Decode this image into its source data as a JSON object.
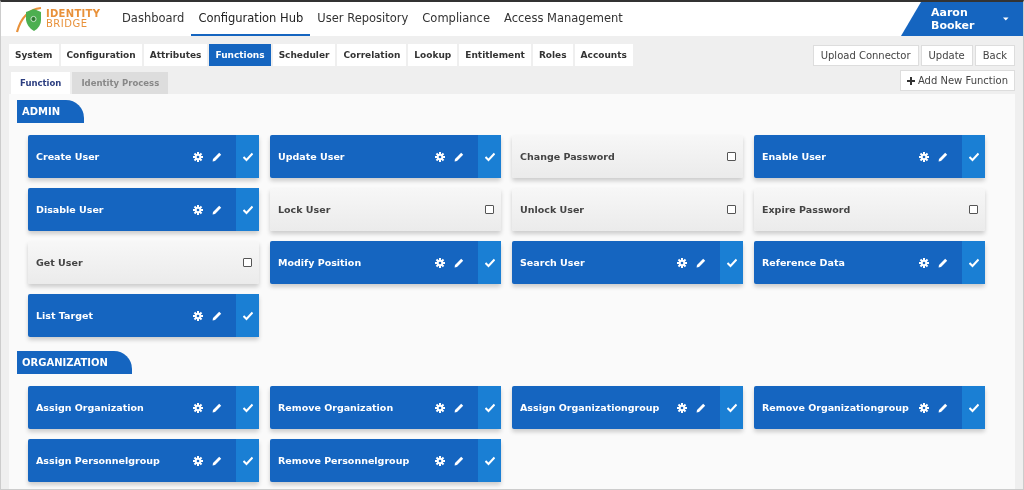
{
  "logo": {
    "line_1": "IDENTITY",
    "line_2": "BRIDGE"
  },
  "nav": [
    {
      "label": "Dashboard",
      "selected": false
    },
    {
      "label": "Configuration Hub",
      "selected": true
    },
    {
      "label": "User Repository",
      "selected": false
    },
    {
      "label": "Compliance",
      "selected": false
    },
    {
      "label": "Access Management",
      "selected": false
    }
  ],
  "user": {
    "name": "Aaron Booker"
  },
  "tabs": [
    {
      "label": "System",
      "selected": false
    },
    {
      "label": "Configuration",
      "selected": false
    },
    {
      "label": "Attributes",
      "selected": false
    },
    {
      "label": "Functions",
      "selected": true
    },
    {
      "label": "Scheduler",
      "selected": false
    },
    {
      "label": "Correlation",
      "selected": false
    },
    {
      "label": "Lookup",
      "selected": false
    },
    {
      "label": "Entitlement",
      "selected": false
    },
    {
      "label": "Roles",
      "selected": false
    },
    {
      "label": "Accounts",
      "selected": false
    }
  ],
  "actions": [
    "Upload Connector",
    "Update",
    "Back"
  ],
  "subtabs": [
    {
      "label": "Function",
      "selected": true
    },
    {
      "label": "Identity Process",
      "selected": false
    }
  ],
  "add_button": "Add New Function",
  "sections": [
    {
      "title": "ADMIN",
      "functions": [
        {
          "name": "Create User",
          "checked": true
        },
        {
          "name": "Update User",
          "checked": true
        },
        {
          "name": "Change Password",
          "checked": false
        },
        {
          "name": "Enable User",
          "checked": true
        },
        {
          "name": "Disable User",
          "checked": true
        },
        {
          "name": "Lock User",
          "checked": false
        },
        {
          "name": "Unlock User",
          "checked": false
        },
        {
          "name": "Expire Password",
          "checked": false
        },
        {
          "name": "Get User",
          "checked": false
        },
        {
          "name": "Modify Position",
          "checked": true
        },
        {
          "name": "Search User",
          "checked": true
        },
        {
          "name": "Reference Data",
          "checked": true
        },
        {
          "name": "List Target",
          "checked": true
        }
      ]
    },
    {
      "title": "ORGANIZATION",
      "functions": [
        {
          "name": "Assign Organization",
          "checked": true
        },
        {
          "name": "Remove Organization",
          "checked": true
        },
        {
          "name": "Assign Organizationgroup",
          "checked": true
        },
        {
          "name": "Remove Organizationgroup",
          "checked": true
        },
        {
          "name": "Assign Personnelgroup",
          "checked": true
        },
        {
          "name": "Remove Personnelgroup",
          "checked": true
        }
      ]
    }
  ]
}
